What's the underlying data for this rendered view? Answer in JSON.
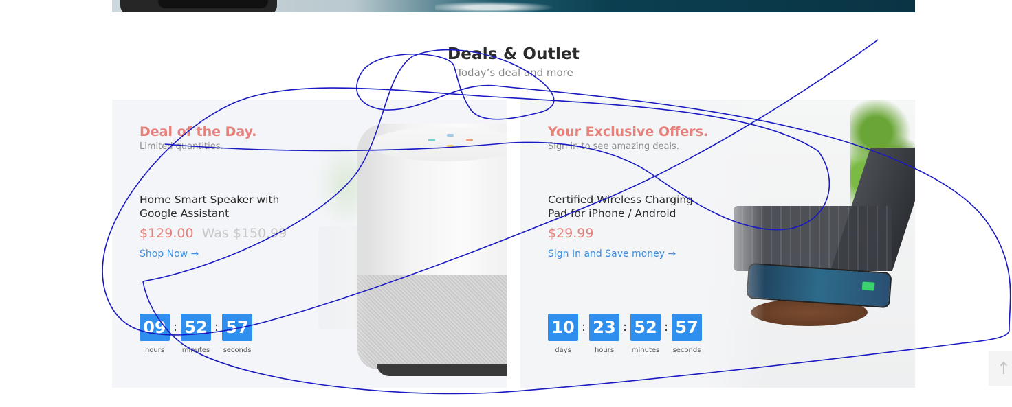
{
  "section": {
    "title": "Deals & Outlet",
    "subtitle": "Today’s deal and more"
  },
  "deal_of_day": {
    "heading": "Deal of the Day.",
    "subheading": "Limited quantities.",
    "product_name": "Home Smart Speaker with Google Assistant",
    "price": "$129.00",
    "was_price": "Was $150.99",
    "cta": "Shop Now →",
    "countdown": [
      {
        "value": "09",
        "label": "hours"
      },
      {
        "value": "52",
        "label": "minutes"
      },
      {
        "value": "57",
        "label": "seconds"
      }
    ],
    "image_icon": "smart-speaker"
  },
  "exclusive_offers": {
    "heading": "Your Exclusive Offers.",
    "subheading": "Sign in to see amazing deals.",
    "product_name": "Certified Wireless Charging Pad for iPhone / Android",
    "price": "$29.99",
    "cta": "Sign In and Save money →",
    "countdown": [
      {
        "value": "10",
        "label": "days"
      },
      {
        "value": "23",
        "label": "hours"
      },
      {
        "value": "52",
        "label": "minutes"
      },
      {
        "value": "57",
        "label": "seconds"
      }
    ],
    "image_icon": "wireless-charging-desk"
  },
  "countdown_separator": ":",
  "scroll_top_label": "↑",
  "colors": {
    "accent_red": "#e6807b",
    "link_blue": "#3d8fe3",
    "countdown_blue": "#2f8fef",
    "scribble_blue": "#1a1ac2"
  }
}
